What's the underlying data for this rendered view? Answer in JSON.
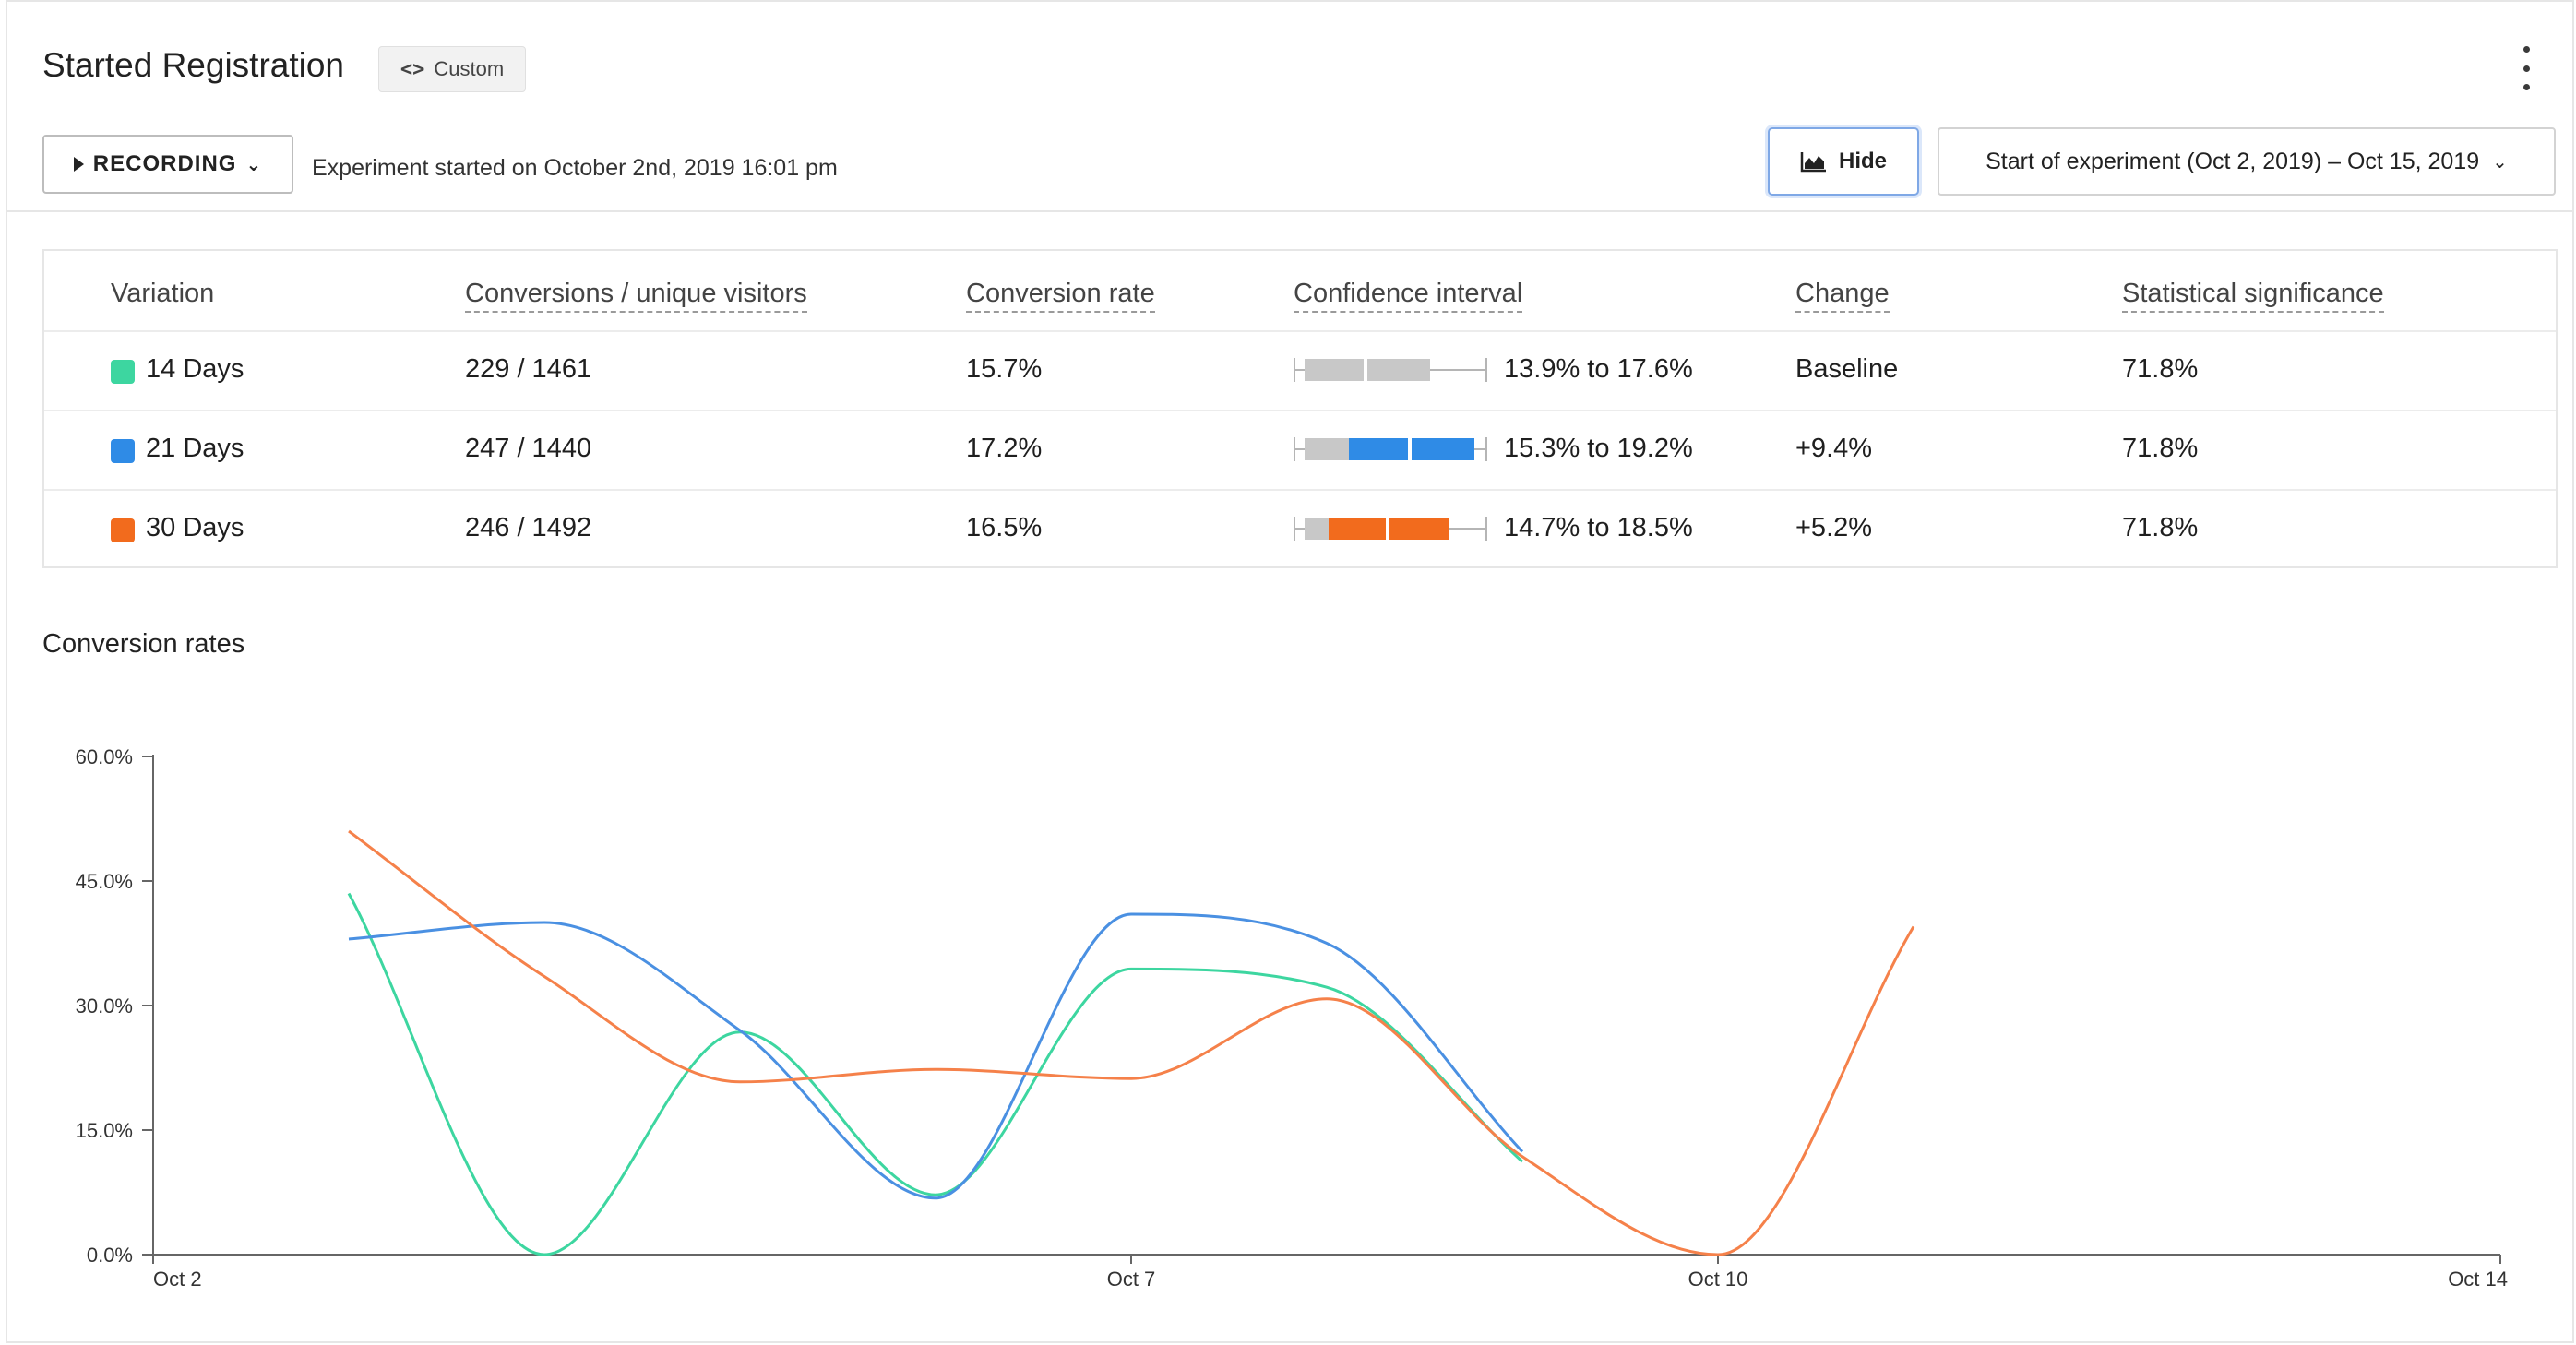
{
  "header": {
    "title": "Started Registration",
    "badge_icon": "code-icon",
    "badge_glyph": "<>",
    "badge_label": "Custom",
    "more_menu_icon": "vertical-ellipsis-icon"
  },
  "toolbar": {
    "recording_label": "RECORDING",
    "recording_icon": "play-icon",
    "experiment_text": "Experiment started on October 2nd, 2019 16:01 pm",
    "hide_label": "Hide",
    "hide_icon": "area-chart-icon",
    "date_range_label": "Start of experiment (Oct 2, 2019) – Oct 15, 2019"
  },
  "table": {
    "columns": [
      "Variation",
      "Conversions / unique visitors",
      "Conversion rate",
      "Confidence interval",
      "Change",
      "Statistical significance"
    ],
    "rows": [
      {
        "variation": "14 Days",
        "color": "#3dd6a0",
        "conversions": "229 / 1461",
        "rate": "15.7%",
        "ci": "13.9% to 17.6%",
        "change": "Baseline",
        "significance": "71.8%"
      },
      {
        "variation": "21 Days",
        "color": "#2f8be6",
        "conversions": "247 / 1440",
        "rate": "17.2%",
        "ci": "15.3% to 19.2%",
        "change": "+9.4%",
        "significance": "71.8%"
      },
      {
        "variation": "30 Days",
        "color": "#f26b1d",
        "conversions": "246 / 1492",
        "rate": "16.5%",
        "ci": "14.7% to 18.5%",
        "change": "+5.2%",
        "significance": "71.8%"
      }
    ]
  },
  "chart_data": {
    "type": "line",
    "title": "Conversion rates",
    "x_ticks": [
      "Oct 2",
      "Oct 7",
      "Oct 10",
      "Oct 14"
    ],
    "y_ticks": [
      "0.0%",
      "15.0%",
      "30.0%",
      "45.0%",
      "60.0%"
    ],
    "ylim": [
      0,
      60
    ],
    "xlim": [
      "Oct 2",
      "Oct 14"
    ],
    "grid": false,
    "series": [
      {
        "color": "#3dd6a0",
        "points": [
          [
            "Oct 3",
            43.5
          ],
          [
            "Oct 4",
            0
          ],
          [
            "Oct 5",
            26.8
          ],
          [
            "Oct 6",
            7.2
          ],
          [
            "Oct 7",
            34.4
          ],
          [
            "Oct 8",
            32.2
          ],
          [
            "Oct 9",
            11.2
          ]
        ]
      },
      {
        "color": "#4a90e2",
        "points": [
          [
            "Oct 3",
            38
          ],
          [
            "Oct 4",
            40
          ],
          [
            "Oct 5",
            27
          ],
          [
            "Oct 6",
            6.8
          ],
          [
            "Oct 7",
            41
          ],
          [
            "Oct 8",
            37.5
          ],
          [
            "Oct 9",
            12.4
          ]
        ]
      },
      {
        "color": "#f5814a",
        "points": [
          [
            "Oct 3",
            51
          ],
          [
            "Oct 4",
            33.5
          ],
          [
            "Oct 5",
            20.8
          ],
          [
            "Oct 6",
            22.3
          ],
          [
            "Oct 7",
            21.2
          ],
          [
            "Oct 8",
            30.8
          ],
          [
            "Oct 9",
            11.8
          ],
          [
            "Oct 10",
            0
          ],
          [
            "Oct 11",
            39.5
          ]
        ]
      }
    ]
  }
}
